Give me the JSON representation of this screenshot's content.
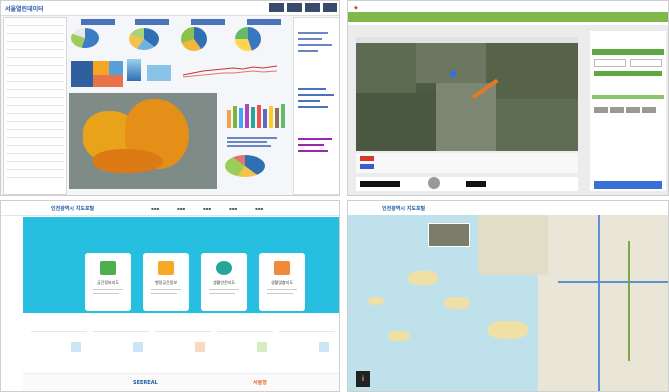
{
  "panel1": {
    "brand": "서울열린데이터"
  },
  "panel2": {},
  "panel3": {
    "brand": "인천광역시 지도포털",
    "cards": [
      "공간정보지도",
      "행정공간정보",
      "생활안전지도",
      "생활맞춤지도"
    ],
    "footer_logos": [
      "SEEREAL",
      "서울형"
    ]
  },
  "panel4": {
    "brand": "인천광역시 지도포털",
    "info_icon": "i"
  },
  "colors": {
    "dashboard_header": "#4b73b8",
    "map_heat": "#e8a31a",
    "portal_hero": "#27bfe0",
    "map_water": "#bfe1ec"
  }
}
